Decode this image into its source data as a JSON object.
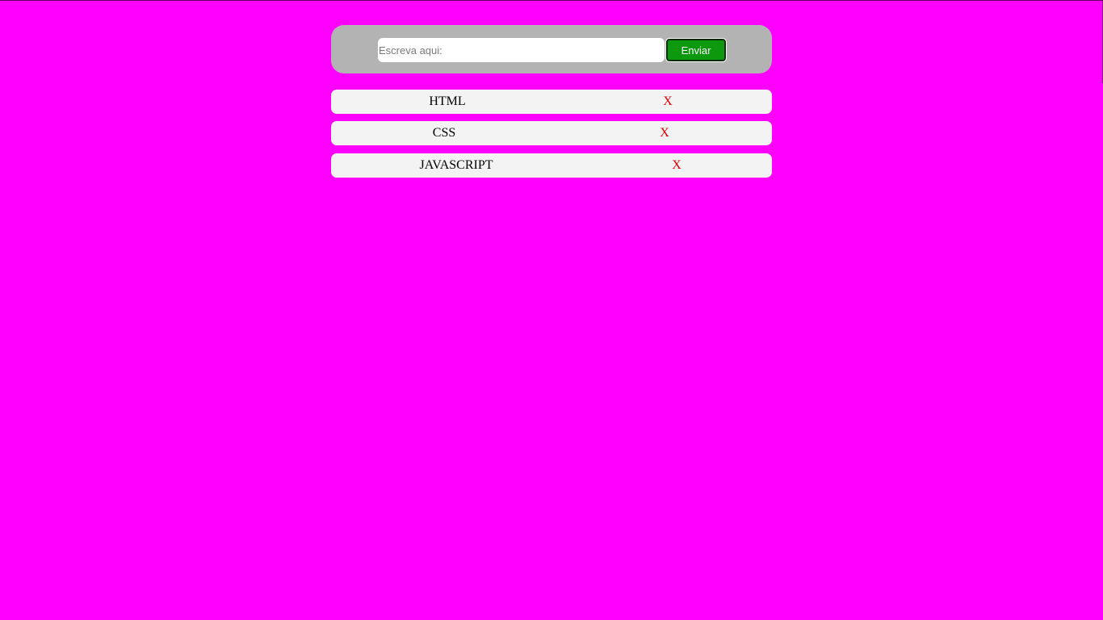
{
  "form": {
    "input_placeholder": "Escreva aqui:",
    "input_value": "",
    "send_label": "Enviar"
  },
  "tasks": [
    {
      "label": "HTML",
      "delete_label": "X"
    },
    {
      "label": "CSS",
      "delete_label": "X"
    },
    {
      "label": "JAVASCRIPT",
      "delete_label": "X"
    }
  ],
  "colors": {
    "background": "#ff00ff",
    "panel": "#b3b3b3",
    "row": "#f3f3f3",
    "button": "#0d990d",
    "delete": "#e00000"
  }
}
